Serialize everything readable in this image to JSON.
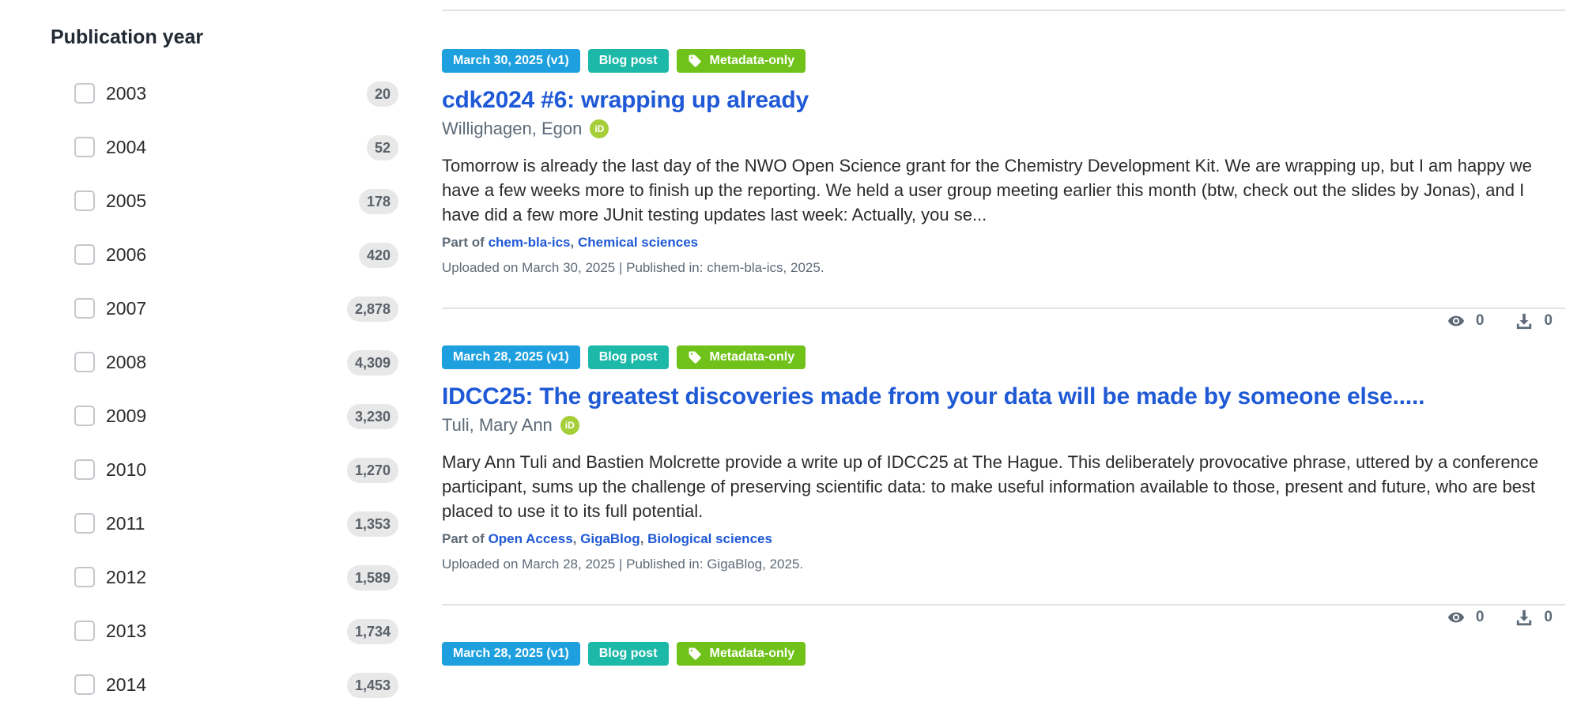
{
  "facet": {
    "title": "Publication year",
    "items": [
      {
        "label": "2003",
        "count": "20"
      },
      {
        "label": "2004",
        "count": "52"
      },
      {
        "label": "2005",
        "count": "178"
      },
      {
        "label": "2006",
        "count": "420"
      },
      {
        "label": "2007",
        "count": "2,878"
      },
      {
        "label": "2008",
        "count": "4,309"
      },
      {
        "label": "2009",
        "count": "3,230"
      },
      {
        "label": "2010",
        "count": "1,270"
      },
      {
        "label": "2011",
        "count": "1,353"
      },
      {
        "label": "2012",
        "count": "1,589"
      },
      {
        "label": "2013",
        "count": "1,734"
      },
      {
        "label": "2014",
        "count": "1,453"
      }
    ]
  },
  "results": [
    {
      "date": "March 30, 2025 (v1)",
      "type": "Blog post",
      "access": "Metadata-only",
      "title": "cdk2024 #6: wrapping up already",
      "creator": "Willighagen, Egon",
      "description": "Tomorrow is already the last day of the NWO Open Science grant for the Chemistry Development Kit. We are wrapping up, but I am happy we have a few weeks more to finish up the reporting. We held a user group meeting earlier this month (btw, check out the slides by Jonas), and I have did a few more JUnit testing updates last week: Actually, you se...",
      "part_of_label": "Part of",
      "communities": [
        "chem-bla-ics",
        "Chemical sciences"
      ],
      "uploaded": "Uploaded on March 30, 2025 | Published in: chem-bla-ics, 2025.",
      "views": "0",
      "downloads": "0"
    },
    {
      "date": "March 28, 2025 (v1)",
      "type": "Blog post",
      "access": "Metadata-only",
      "title": "IDCC25: The greatest discoveries made from your data will be made by someone else.....",
      "creator": "Tuli, Mary Ann",
      "description": "Mary Ann Tuli and Bastien Molcrette provide a write up of IDCC25 at The Hague. This deliberately provocative phrase, uttered by a conference participant, sums up the challenge of preserving scientific data: to make useful information available to those, present and future, who are best placed to use it to its full potential.",
      "part_of_label": "Part of",
      "communities": [
        "Open Access",
        "GigaBlog",
        "Biological sciences"
      ],
      "uploaded": "Uploaded on March 28, 2025 | Published in: GigaBlog, 2025.",
      "views": "0",
      "downloads": "0"
    },
    {
      "date": "March 28, 2025 (v1)",
      "type": "Blog post",
      "access": "Metadata-only"
    }
  ],
  "icons": {
    "orcid": "orcid-icon",
    "tag": "tag-icon",
    "views": "eye-icon",
    "downloads": "download-icon"
  },
  "colors": {
    "date_badge": "#1ea0de",
    "type_badge": "#1cb8a8",
    "access_badge": "#70c21a",
    "link": "#1f59d6",
    "orcid": "#a6ce39"
  }
}
